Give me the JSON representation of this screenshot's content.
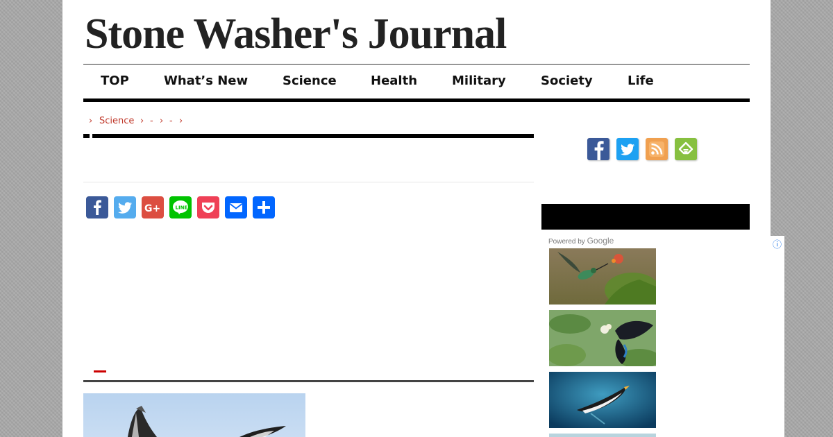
{
  "site": {
    "title": "Stone Washer's Journal"
  },
  "nav": {
    "items": [
      {
        "label": "TOP"
      },
      {
        "label": "What’s New"
      },
      {
        "label": "Science"
      },
      {
        "label": "Health"
      },
      {
        "label": "Military"
      },
      {
        "label": "Society"
      },
      {
        "label": "Life"
      }
    ]
  },
  "breadcrumb": {
    "separator": "›",
    "items": [
      {
        "label": "Science"
      },
      {
        "label": "-"
      },
      {
        "label": "-"
      }
    ]
  },
  "share": {
    "buttons": [
      {
        "icon": "facebook-icon",
        "color": "#3b5998"
      },
      {
        "icon": "twitter-icon",
        "color": "#55acee"
      },
      {
        "icon": "google-plus-icon",
        "color": "#dc4e41"
      },
      {
        "icon": "line-icon",
        "color": "#00c300"
      },
      {
        "icon": "pocket-icon",
        "color": "#ef4056"
      },
      {
        "icon": "email-icon",
        "color": "#0166ff"
      },
      {
        "icon": "share-icon",
        "color": "#0166ff"
      }
    ]
  },
  "social_follow": {
    "icons": [
      {
        "icon": "facebook-icon",
        "color": "#3b5998"
      },
      {
        "icon": "twitter-icon",
        "color": "#1da1f2"
      },
      {
        "icon": "rss-icon",
        "color": "#f0a050"
      },
      {
        "icon": "feedly-icon",
        "color": "#87c040"
      }
    ]
  },
  "ad": {
    "powered_by": "Powered by",
    "brand": "Google",
    "info_icon": "info-icon",
    "thumbnails": [
      {
        "subject": "hummingbird"
      },
      {
        "subject": "butterfly"
      },
      {
        "subject": "penguin"
      }
    ]
  },
  "colors": {
    "accent_red": "#c0392b",
    "nav_border": "#000000"
  }
}
